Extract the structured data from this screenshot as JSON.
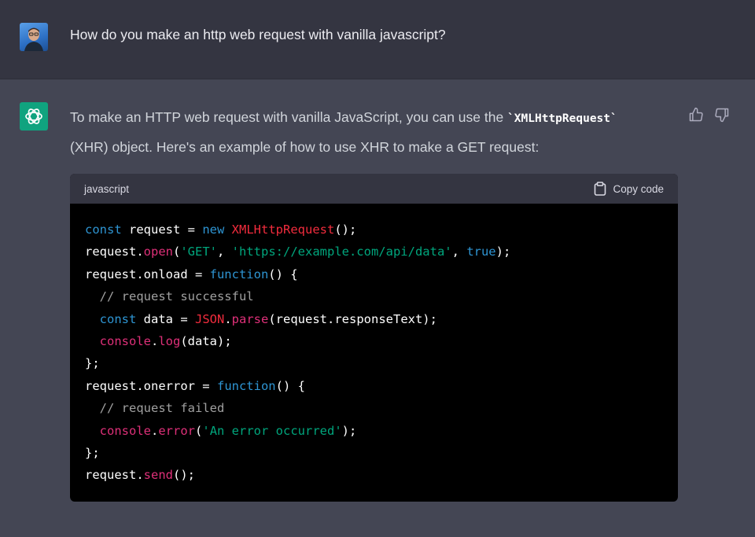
{
  "user": {
    "message": "How do you make an http web request with vanilla javascript?"
  },
  "assistant": {
    "intro_part1": "To make an HTTP web request with vanilla JavaScript, you can use the ",
    "intro_code": "`XMLHttpRequest`",
    "intro_part2": "(XHR) object. Here's an example of how to use XHR to make a GET request:"
  },
  "code_block": {
    "language": "javascript",
    "copy_label": "Copy code",
    "lines": [
      [
        [
          "kw",
          "const"
        ],
        [
          "plain",
          " request = "
        ],
        [
          "kw",
          "new"
        ],
        [
          "plain",
          " "
        ],
        [
          "cls",
          "XMLHttpRequest"
        ],
        [
          "plain",
          "();"
        ]
      ],
      [
        [
          "plain",
          "request."
        ],
        [
          "fn",
          "open"
        ],
        [
          "plain",
          "("
        ],
        [
          "str",
          "'GET'"
        ],
        [
          "plain",
          ", "
        ],
        [
          "str",
          "'https://example.com/api/data'"
        ],
        [
          "plain",
          ", "
        ],
        [
          "kw",
          "true"
        ],
        [
          "plain",
          ");"
        ]
      ],
      [
        [
          "plain",
          "request.onload = "
        ],
        [
          "kw",
          "function"
        ],
        [
          "plain",
          "() {"
        ]
      ],
      [
        [
          "plain",
          "  "
        ],
        [
          "cm",
          "// request successful"
        ]
      ],
      [
        [
          "plain",
          "  "
        ],
        [
          "kw",
          "const"
        ],
        [
          "plain",
          " data = "
        ],
        [
          "cls",
          "JSON"
        ],
        [
          "plain",
          "."
        ],
        [
          "fn",
          "parse"
        ],
        [
          "plain",
          "(request.responseText);"
        ]
      ],
      [
        [
          "plain",
          "  "
        ],
        [
          "fn",
          "console"
        ],
        [
          "plain",
          "."
        ],
        [
          "fn",
          "log"
        ],
        [
          "plain",
          "(data);"
        ]
      ],
      [
        [
          "plain",
          "};"
        ]
      ],
      [
        [
          "plain",
          "request.onerror = "
        ],
        [
          "kw",
          "function"
        ],
        [
          "plain",
          "() {"
        ]
      ],
      [
        [
          "plain",
          "  "
        ],
        [
          "cm",
          "// request failed"
        ]
      ],
      [
        [
          "plain",
          "  "
        ],
        [
          "fn",
          "console"
        ],
        [
          "plain",
          "."
        ],
        [
          "fn",
          "error"
        ],
        [
          "plain",
          "("
        ],
        [
          "str",
          "'An error occurred'"
        ],
        [
          "plain",
          ");"
        ]
      ],
      [
        [
          "plain",
          "};"
        ]
      ],
      [
        [
          "plain",
          "request."
        ],
        [
          "fn",
          "send"
        ],
        [
          "plain",
          "();"
        ]
      ]
    ]
  },
  "icons": {
    "user_avatar": "user-avatar-photo",
    "assistant_avatar": "openai-logo-icon",
    "thumbs_up": "thumbs-up-icon",
    "thumbs_down": "thumbs-down-icon",
    "copy": "clipboard-icon"
  },
  "colors": {
    "user_bg": "#343541",
    "assistant_bg": "#444654",
    "code_bg": "#000000",
    "code_header_bg": "#343541",
    "brand_green": "#10a37f",
    "keyword": "#2e95d3",
    "function": "#df3079",
    "class": "#f22c3d",
    "string": "#00a67d",
    "comment": "#a0a0a0"
  }
}
